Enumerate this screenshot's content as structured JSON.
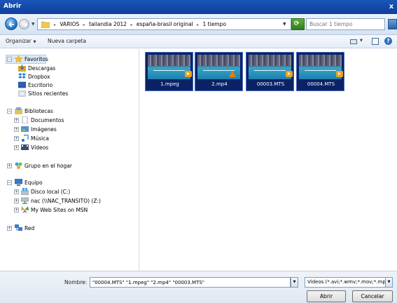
{
  "window": {
    "title": "Abrir",
    "close_glyph": "x"
  },
  "address": {
    "crumbs": [
      "VARIOS",
      "tailandia 2012",
      "españa-brasil original",
      "1 tiempo"
    ],
    "separator": "▸"
  },
  "search": {
    "placeholder": "Buscar 1 tiempo"
  },
  "toolbar": {
    "organize_label": "Organizar",
    "new_folder_label": "Nueva carpeta"
  },
  "nav": {
    "favorites": {
      "label": "Favoritos",
      "items": [
        "Descargas",
        "Dropbox",
        "Escritorio",
        "Sitios recientes"
      ]
    },
    "libraries": {
      "label": "Bibliotecas",
      "items": [
        "Documentos",
        "Imágenes",
        "Música",
        "Vídeos"
      ]
    },
    "homegroup": {
      "label": "Grupo en el hogar"
    },
    "computer": {
      "label": "Equipo",
      "items": [
        "Disco local (C:)",
        "nac (\\\\NAC_TRANSITO) (Z:)",
        "My Web Sites on MSN"
      ]
    },
    "network": {
      "label": "Red"
    }
  },
  "files": [
    {
      "name": "1.mpeg",
      "badge": "play"
    },
    {
      "name": "2.mp4",
      "badge": "vlc"
    },
    {
      "name": "00003.MTS",
      "badge": "play"
    },
    {
      "name": "00004.MTS",
      "badge": "play"
    }
  ],
  "footer": {
    "filename_label": "Nombre:",
    "filename_value": "\"00004.MTS\" \"1.mpeg\" \"2.mp4\" \"00003.MTS\"",
    "filetype_value": "Videos (*.avi;*.wmv;*.mov;*.mp",
    "open_label": "Abrir",
    "cancel_label": "Cancelar"
  },
  "colors": {
    "titlebar": "#1a56b8",
    "selection": "#0a2366",
    "accent": "#2b63aa"
  }
}
